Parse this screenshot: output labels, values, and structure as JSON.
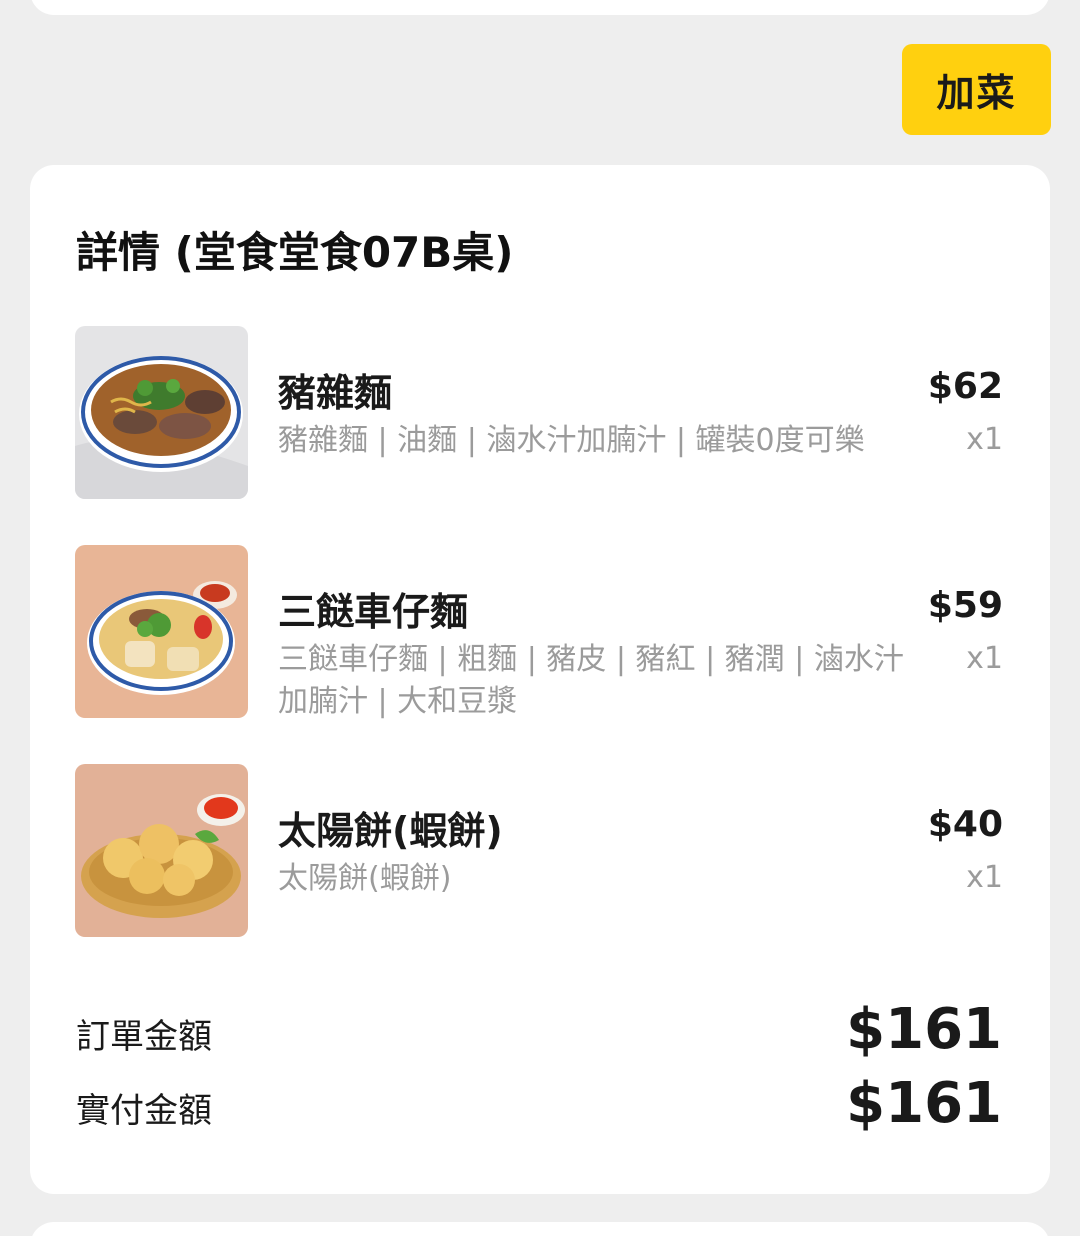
{
  "actions": {
    "add_dish_label": "加菜"
  },
  "detail": {
    "title": "詳情 (堂食堂食07B桌)"
  },
  "items": [
    {
      "name": "豬雜麵",
      "description": "豬雜麵 | 油麵 | 滷水汁加腩汁 | 罐裝0度可樂",
      "price": "$62",
      "quantity": "x1"
    },
    {
      "name": "三餸車仔麵",
      "description": "三餸車仔麵 | 粗麵 | 豬皮 | 豬紅 | 豬潤 | 滷水汁加腩汁 | 大和豆漿",
      "price": "$59",
      "quantity": "x1"
    },
    {
      "name": "太陽餅(蝦餅)",
      "description": "太陽餅(蝦餅)",
      "price": "$40",
      "quantity": "x1"
    }
  ],
  "summary": {
    "order_amount_label": "訂單金額",
    "order_amount_value": "$161",
    "paid_amount_label": "實付金額",
    "paid_amount_value": "$161"
  },
  "colors": {
    "accent_button": "#ffd00f",
    "background": "#eeeeee",
    "card": "#ffffff",
    "secondary_text": "#9b9b9b"
  }
}
